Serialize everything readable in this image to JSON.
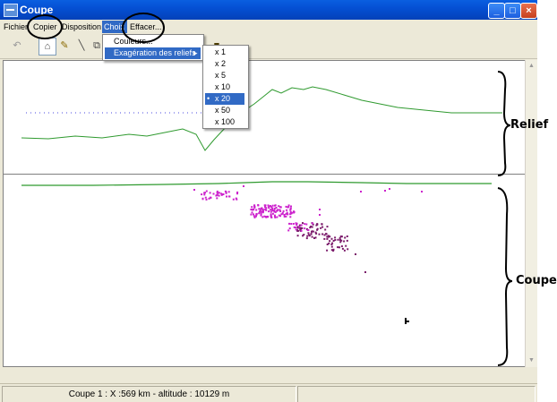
{
  "window": {
    "title": "Coupe"
  },
  "title_buttons": {
    "minimize": "_",
    "maximize": "□",
    "close": "×"
  },
  "menu": {
    "items": [
      {
        "label": "Fichier"
      },
      {
        "label": "Copier"
      },
      {
        "label": "Disposition"
      },
      {
        "label": "Choix"
      },
      {
        "label": "Effacer..."
      }
    ]
  },
  "choix_menu": {
    "items": [
      {
        "label": "Couleurs..."
      },
      {
        "label": "Exagération des reliefs"
      }
    ],
    "submenu_arrow": "▸"
  },
  "relief_submenu": {
    "items": [
      "x 1",
      "x 2",
      "x 5",
      "x 10",
      "x 20",
      "x 50",
      "x 100"
    ],
    "selected": "x 20",
    "bullet": "•"
  },
  "toolbar": {
    "icons": [
      "undo-icon",
      "section-icon",
      "pencil-icon",
      "line-icon",
      "copy-icon",
      "color-swatch-icon"
    ],
    "glyphs": [
      "↶",
      "⌂",
      "✎",
      "╲",
      "⧉",
      "■"
    ]
  },
  "annotations": {
    "relief": "Relief",
    "coupe": "Coupe"
  },
  "status": {
    "text": "Coupe 1 : X :569 km  - altitude : 10129 m"
  },
  "colors": {
    "title_bar": "#0550d4",
    "menu_highlight": "#316ac5",
    "relief_line": "#2f9a2f",
    "profile_dots": "#4a4ae0",
    "quake_magenta": "#cc22cc",
    "quake_purple": "#7a1a6a"
  }
}
